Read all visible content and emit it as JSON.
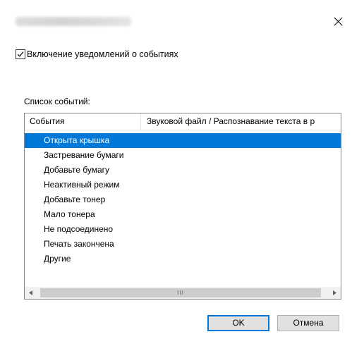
{
  "window": {
    "title_blurred": true
  },
  "notifications_checkbox": {
    "checked": true,
    "label": "Включение уведомлений о событиях"
  },
  "events_list": {
    "label": "Список событий:",
    "columns": [
      "События",
      "Звуковой файл / Распознавание текста в р"
    ],
    "items": [
      "Открыта крышка",
      "Застревание бумаги",
      "Добавьте бумагу",
      "Неактивный режим",
      "Добавьте тонер",
      "Мало тонера",
      "Не подсоединено",
      "Печать закончена",
      "Другие"
    ],
    "selected_index": 0,
    "scroll_grip": "III"
  },
  "buttons": {
    "ok": "OK",
    "cancel": "Отмена"
  },
  "colors": {
    "selection": "#0078d7",
    "accent": "#0078d7"
  },
  "icons": {
    "close": "close-icon",
    "check": "checkmark-icon",
    "left": "arrow-left-icon",
    "right": "arrow-right-icon"
  }
}
